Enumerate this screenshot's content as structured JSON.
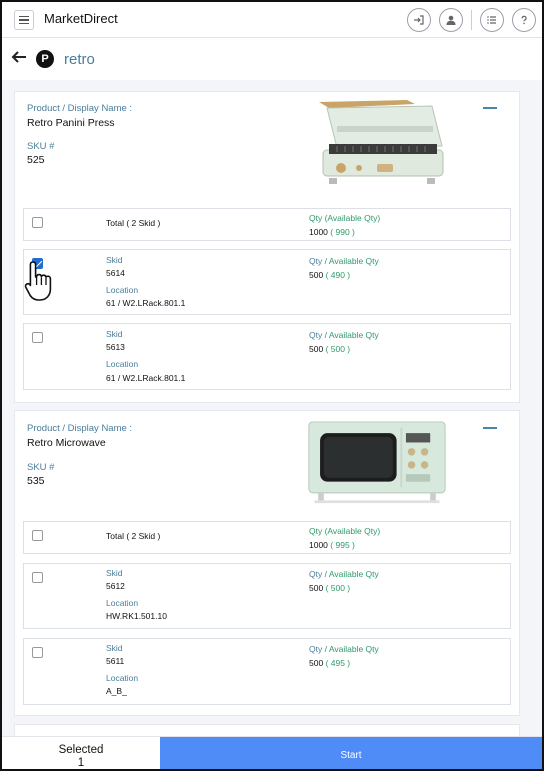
{
  "app": {
    "title": "MarketDirect"
  },
  "header": {
    "search_term": "retro",
    "badge": "P"
  },
  "products": [
    {
      "name_label": "Product / Display Name :",
      "name": "Retro Panini Press",
      "sku_label": "SKU #",
      "sku": "525",
      "total": {
        "prefix": "Total ( ",
        "count": "2",
        "suffix": " Skid )",
        "qty_label": "Qty (Available Qty)",
        "qty": "1000",
        "avail": "( 990 )",
        "checked": false
      },
      "skids": [
        {
          "skid_label": "Skid",
          "skid": "5614",
          "loc_label": "Location",
          "location": "61 / W2.LRack.801.1",
          "qty_label_a": "Qty",
          "qty_label_b": "Available Qty",
          "qty": "500",
          "avail": "( 490 )",
          "checked": true
        },
        {
          "skid_label": "Skid",
          "skid": "5613",
          "loc_label": "Location",
          "location": "61 / W2.LRack.801.1",
          "qty_label_a": "Qty",
          "qty_label_b": "Available Qty",
          "qty": "500",
          "avail": "( 500 )",
          "checked": false
        }
      ]
    },
    {
      "name_label": "Product / Display Name :",
      "name": "Retro Microwave",
      "sku_label": "SKU #",
      "sku": "535",
      "total": {
        "prefix": "Total ( ",
        "count": "2",
        "suffix": " Skid )",
        "qty_label": "Qty (Available Qty)",
        "qty": "1000",
        "avail": "( 995 )",
        "checked": false
      },
      "skids": [
        {
          "skid_label": "Skid",
          "skid": "5612",
          "loc_label": "Location",
          "location": "HW.RK1.501.10",
          "qty_label_a": "Qty",
          "qty_label_b": "Available Qty",
          "qty": "500",
          "avail": "( 500 )",
          "checked": false
        },
        {
          "skid_label": "Skid",
          "skid": "5611",
          "loc_label": "Location",
          "location": "A_B_",
          "qty_label_a": "Qty",
          "qty_label_b": "Available Qty",
          "qty": "500",
          "avail": "( 495 )",
          "checked": false
        }
      ]
    }
  ],
  "footer": {
    "selected_label": "Selected",
    "selected_count": "1",
    "start_label": "Start"
  },
  "icons": {
    "menu": "hamburger-icon",
    "login": "sign-in-icon",
    "user": "user-icon",
    "list": "list-icon",
    "help": "help-icon",
    "back": "arrow-left-icon",
    "collapse": "minus-icon",
    "cursor": "hand-pointer-icon"
  },
  "colors": {
    "accent_blue": "#4f8cf8",
    "label_teal": "#4a7d9a",
    "available_green": "#2e9a6b",
    "checkbox_checked": "#1f6fd1"
  }
}
